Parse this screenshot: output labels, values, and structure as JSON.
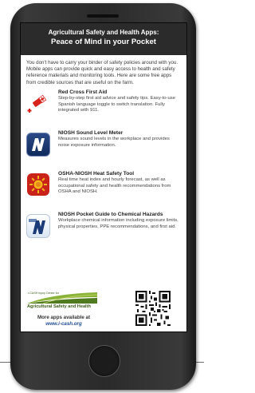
{
  "header": {
    "line1": "Agricultural Safety and Health Apps:",
    "line2": "Peace of Mind in your Pocket"
  },
  "intro": "You don't have to carry your binder of safety policies around with you. Mobile apps can provide quick and easy access to health and safety reference materials and monitoring tools. Here are some free apps from credible sources that are useful on the farm.",
  "apps": [
    {
      "name": "Red Cross First Aid",
      "desc": "Step-by-step first aid advice and safety tips. Easy-to-use Spanish language toggle to switch translation. Fully integrated with 911.",
      "icon": "red-cross-first-aid-icon"
    },
    {
      "name": "NIOSH Sound Level Meter",
      "desc": "Measures sound levels in the workplace and provides noise exposure information.",
      "icon": "niosh-sound-meter-icon"
    },
    {
      "name": "OSHA-NIOSH Heat Safety Tool",
      "desc": "Real time heat index and hourly forecast, as well as occupational safety and health recommendations from OSHA and NIOSH.",
      "icon": "sun-heat-icon"
    },
    {
      "name": "NIOSH Pocket Guide to Chemical Hazards",
      "desc": "Workplace chemical information including exposure limits, physical properties, PPE recommendations, and first aid.",
      "icon": "niosh-chemical-hazards-icon"
    }
  ],
  "footer": {
    "logo_small": "I-CASH Injury Center for",
    "logo_main": "Agricultural Safety and Health",
    "more": "More apps available at",
    "url": "www.i-cash.org"
  },
  "colors": {
    "header_bg": "#2b2b2b",
    "red_cross": "#d7231c",
    "niosh_blue": "#1a3a78",
    "sun_red": "#c8221a",
    "sun_yellow": "#f5b61a",
    "logo_green": "#3a5a1a",
    "url_blue": "#1f4c8f"
  }
}
